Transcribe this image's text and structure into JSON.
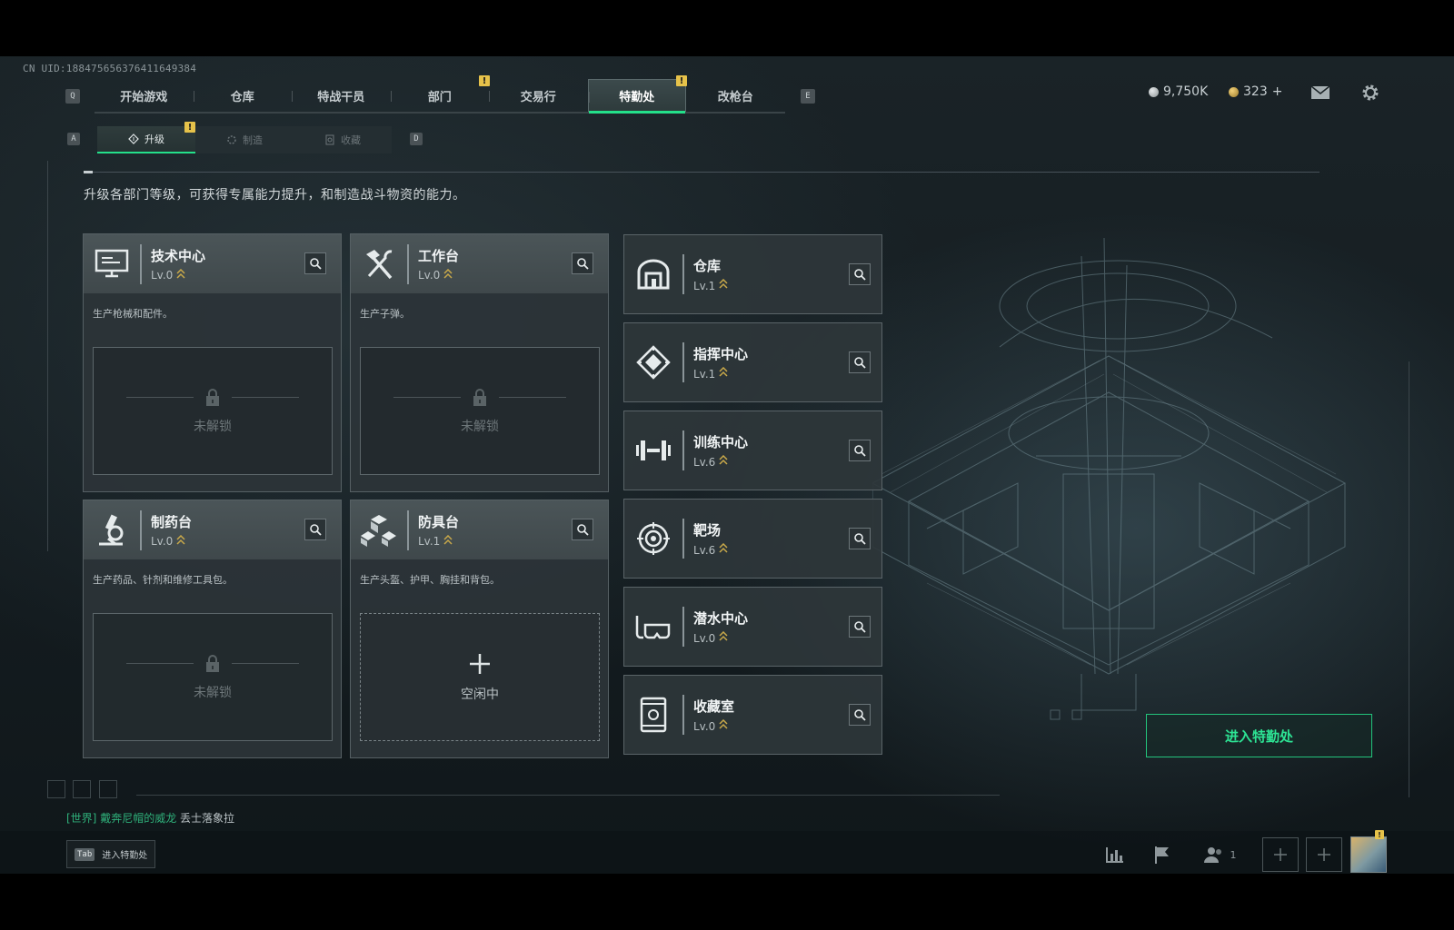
{
  "uid": "CN UID:18847565637641164938​4",
  "main_nav": {
    "left_key": "Q",
    "right_key": "E",
    "tabs": [
      {
        "label": "开始游戏",
        "alert": false
      },
      {
        "label": "仓库",
        "alert": false
      },
      {
        "label": "特战干员",
        "alert": false
      },
      {
        "label": "部门",
        "alert": true
      },
      {
        "label": "交易行",
        "alert": false
      },
      {
        "label": "特勤处",
        "alert": true,
        "active": true
      },
      {
        "label": "改枪台",
        "alert": false
      }
    ],
    "alert_mark": "!"
  },
  "currency": {
    "silver": "9,750K",
    "gold": "323",
    "gold_add": "+"
  },
  "sub_nav": {
    "left_key": "A",
    "right_key": "D",
    "tabs": [
      {
        "label": "升级",
        "active": true,
        "alert": true
      },
      {
        "label": "制造",
        "active": false
      },
      {
        "label": "收藏",
        "active": false
      }
    ]
  },
  "subtitle": "升级各部门等级，可获得专属能力提升，和制造战斗物资的能力。",
  "big_cards": [
    {
      "title": "技术中心",
      "level": "Lv.0",
      "desc": "生产枪械和配件。",
      "slot_status": "未解锁",
      "icon": "monitor-icon"
    },
    {
      "title": "工作台",
      "level": "Lv.0",
      "desc": "生产子弹。",
      "slot_status": "未解锁",
      "icon": "hammer-wrench-icon"
    },
    {
      "title": "制药台",
      "level": "Lv.0",
      "desc": "生产药品、针剂和维修工具包。",
      "slot_status": "未解锁",
      "icon": "microscope-icon"
    },
    {
      "title": "防具台",
      "level": "Lv.1",
      "desc": "生产头盔、护甲、胸挂和背包。",
      "slot_status": "空闲中",
      "icon": "cubes-icon"
    }
  ],
  "departments": [
    {
      "title": "仓库",
      "level": "Lv.1",
      "icon": "vault-icon"
    },
    {
      "title": "指挥中心",
      "level": "Lv.1",
      "icon": "command-chip-icon"
    },
    {
      "title": "训练中心",
      "level": "Lv.6",
      "icon": "dumbbell-icon"
    },
    {
      "title": "靶场",
      "level": "Lv.6",
      "icon": "crosshair-icon"
    },
    {
      "title": "潜水中心",
      "level": "Lv.0",
      "icon": "diving-mask-icon"
    },
    {
      "title": "收藏室",
      "level": "Lv.0",
      "icon": "collection-case-icon"
    }
  ],
  "enter_button": "进入特勤处",
  "chat": {
    "channel": "[世界]",
    "sender": "戴奔尼帽的威龙",
    "message": "丢士落象拉"
  },
  "tab_hint": {
    "key": "Tab",
    "label": "进入特勤处"
  },
  "team_count": "1",
  "colors": {
    "accent_green": "#24e08a",
    "alert_yellow": "#e6c24a",
    "level_chevron": "#c9a94a"
  }
}
